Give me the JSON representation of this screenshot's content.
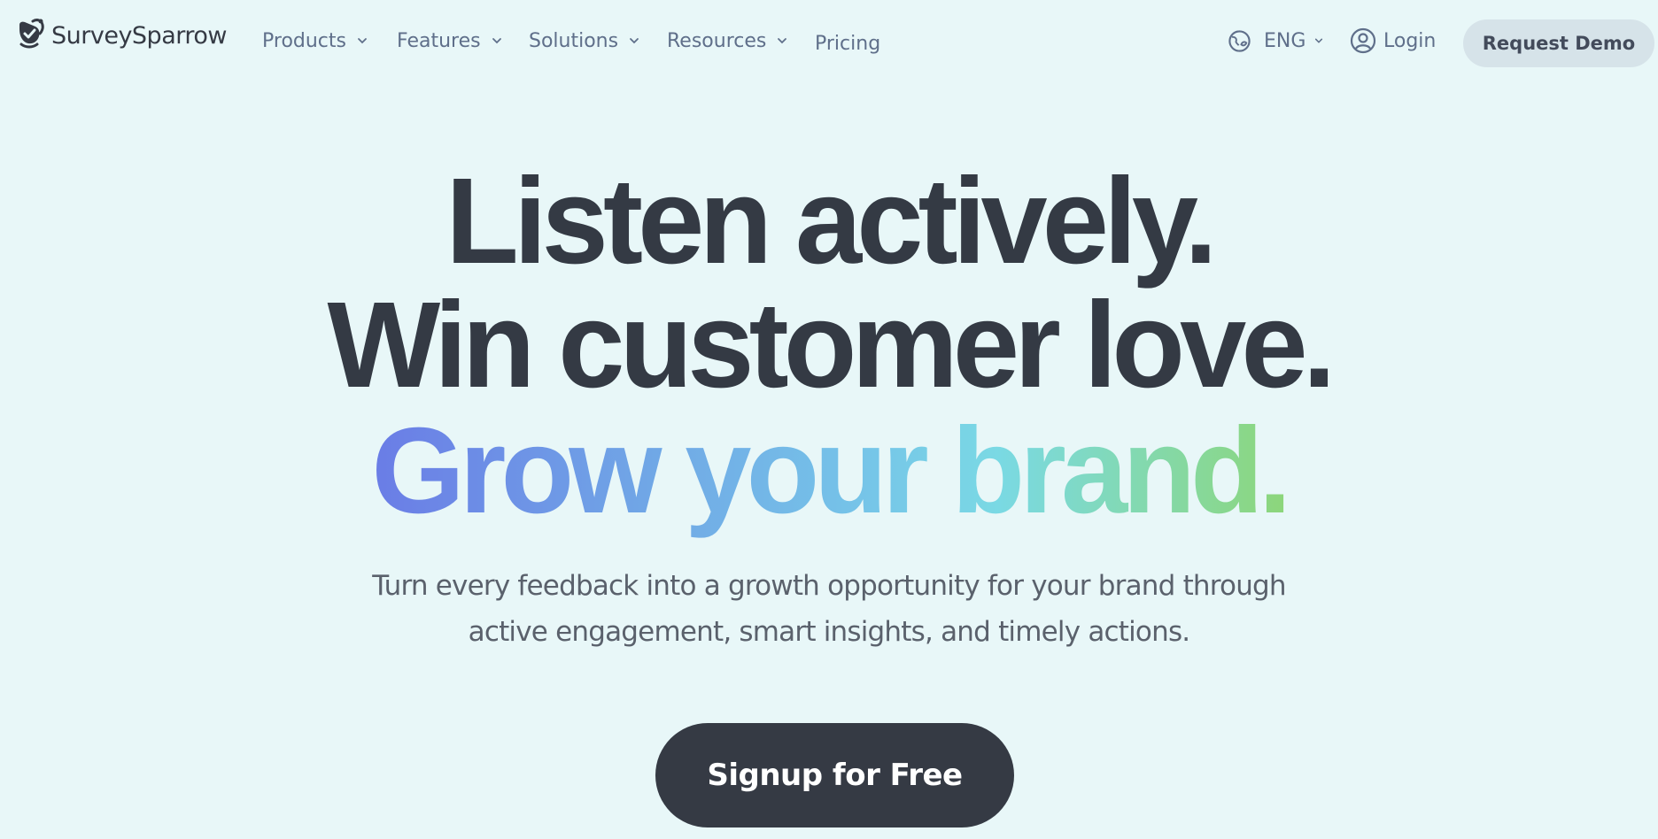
{
  "brand": {
    "name": "SurveySparrow",
    "logo_icon": "sparrow-check-icon"
  },
  "nav": {
    "items": [
      {
        "label": "Products",
        "has_dropdown": true
      },
      {
        "label": "Features",
        "has_dropdown": true
      },
      {
        "label": "Solutions",
        "has_dropdown": true
      },
      {
        "label": "Resources",
        "has_dropdown": true
      },
      {
        "label": "Pricing",
        "has_dropdown": false
      }
    ],
    "language": {
      "label": "ENG",
      "icon": "globe-icon"
    },
    "login": {
      "label": "Login",
      "icon": "user-circle-icon"
    },
    "request_demo": "Request Demo"
  },
  "hero": {
    "line1": "Listen actively.",
    "line2": "Win customer love.",
    "line3": "Grow your brand.",
    "subtitle_line1": "Turn every feedback into a growth opportunity for your brand through",
    "subtitle_line2": "active engagement, smart insights, and timely actions.",
    "cta": "Signup for Free"
  },
  "colors": {
    "background": "#e8f7f8",
    "text_dark": "#343a44",
    "nav_text": "#5f6f8a",
    "demo_button_bg": "#d6e3e9",
    "gradient_start": "#6a7be6",
    "gradient_mid": "#7ad9e4",
    "gradient_end": "#8dd677"
  }
}
